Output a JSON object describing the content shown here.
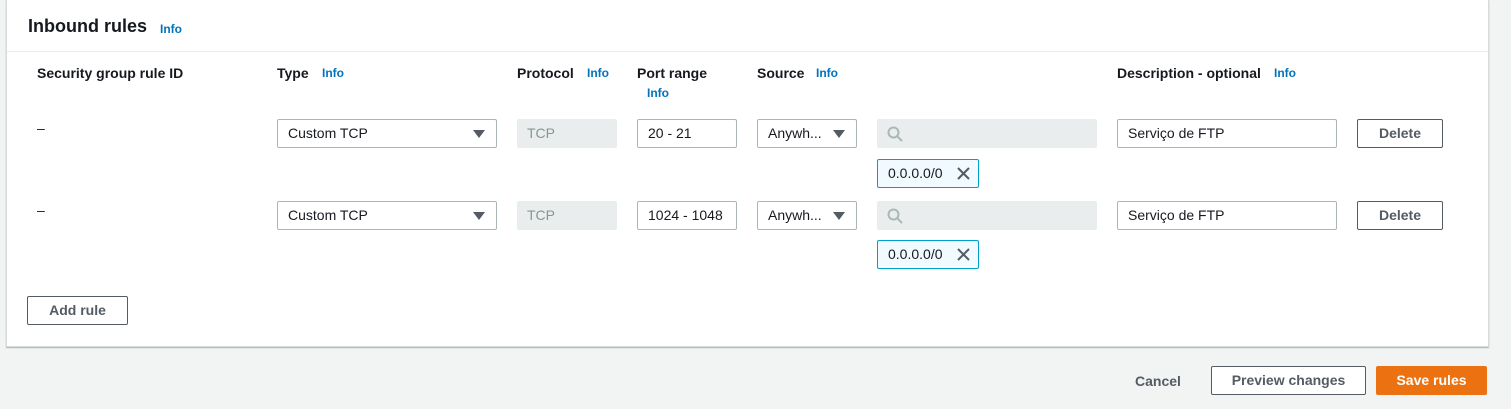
{
  "section": {
    "title": "Inbound rules",
    "info_label": "Info"
  },
  "columns": {
    "rule_id": "Security group rule ID",
    "type": "Type",
    "protocol": "Protocol",
    "port_range": "Port range",
    "source": "Source",
    "description": "Description - optional"
  },
  "rules": [
    {
      "rule_id": "–",
      "type": "Custom TCP",
      "protocol": "TCP",
      "port_range": "20 - 21",
      "source": "Anywh...",
      "search_placeholder": "",
      "cidr": "0.0.0.0/0",
      "description": "Serviço de FTP",
      "delete_label": "Delete"
    },
    {
      "rule_id": "–",
      "type": "Custom TCP",
      "protocol": "TCP",
      "port_range": "1024 - 1048",
      "source": "Anywh...",
      "search_placeholder": "",
      "cidr": "0.0.0.0/0",
      "description": "Serviço de FTP",
      "delete_label": "Delete"
    }
  ],
  "add_rule_label": "Add rule",
  "footer": {
    "cancel_label": "Cancel",
    "preview_label": "Preview changes",
    "save_label": "Save rules"
  },
  "colors": {
    "primary": "#ec7211",
    "info_link": "#0073bb",
    "token_border": "#00a1c9"
  }
}
